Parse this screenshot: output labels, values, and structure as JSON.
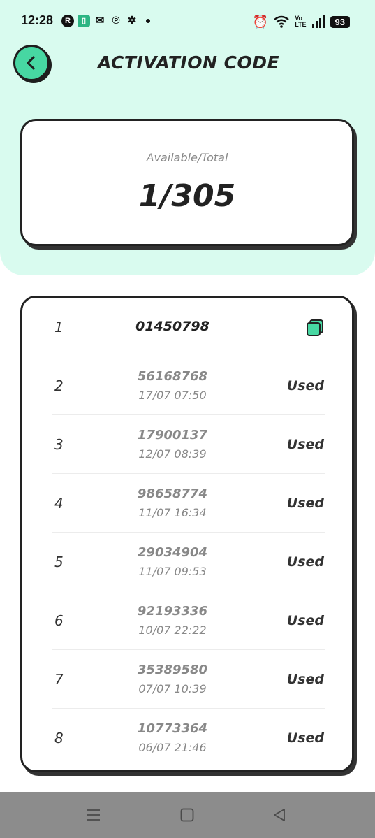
{
  "status_bar": {
    "time": "12:28",
    "battery": "93",
    "volte_top": "Vo",
    "volte_bottom": "LTE"
  },
  "header": {
    "title": "ACTIVATION CODE",
    "back_icon": "chevron-left-icon"
  },
  "summary": {
    "label": "Available/Total",
    "value": "1/305"
  },
  "codes": [
    {
      "index": "1",
      "code": "01450798",
      "date": "",
      "status": "",
      "action_icon": "copy-icon"
    },
    {
      "index": "2",
      "code": "56168768",
      "date": "17/07 07:50",
      "status": "Used"
    },
    {
      "index": "3",
      "code": "17900137",
      "date": "12/07 08:39",
      "status": "Used"
    },
    {
      "index": "4",
      "code": "98658774",
      "date": "11/07 16:34",
      "status": "Used"
    },
    {
      "index": "5",
      "code": "29034904",
      "date": "11/07 09:53",
      "status": "Used"
    },
    {
      "index": "6",
      "code": "92193336",
      "date": "10/07 22:22",
      "status": "Used"
    },
    {
      "index": "7",
      "code": "35389580",
      "date": "07/07 10:39",
      "status": "Used"
    },
    {
      "index": "8",
      "code": "10773364",
      "date": "06/07 21:46",
      "status": "Used"
    }
  ],
  "nav": {
    "recents_icon": "menu-icon",
    "home_icon": "home-square-icon",
    "back_icon": "back-triangle-icon"
  },
  "colors": {
    "background_top": "#d9fbef",
    "accent": "#47d7a2",
    "nav_bar": "#8c8c8c"
  }
}
